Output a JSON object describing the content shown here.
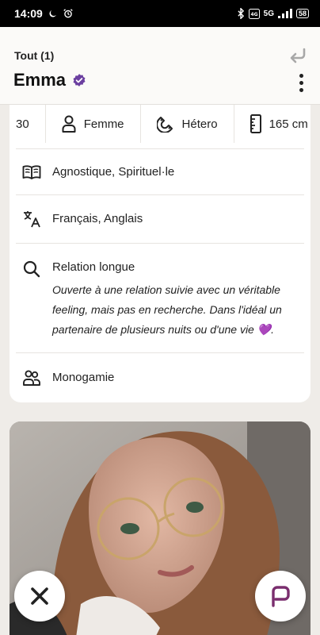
{
  "status_bar": {
    "time": "14:09",
    "net_label": "5G",
    "battery": "58"
  },
  "header": {
    "breadcrumb": "Tout (1)",
    "name": "Emma"
  },
  "chips": [
    {
      "label": "30",
      "icon": "age"
    },
    {
      "label": "Femme",
      "icon": "person-icon"
    },
    {
      "label": "Hétero",
      "icon": "magnet-icon"
    },
    {
      "label": "165 cm",
      "icon": "ruler-icon"
    }
  ],
  "details": {
    "religion": "Agnostique, Spirituel·le",
    "languages": "Français, Anglais",
    "looking_for": {
      "title": "Relation longue",
      "desc_1": "Ouverte à une relation suivie avec un véritable",
      "desc_2": "feeling, mais pas en recherche. Dans l'idéal un",
      "desc_3": "partenaire de plusieurs nuits ou d'une vie 💜."
    },
    "relationship_type": "Monogamie"
  },
  "colors": {
    "accent": "#6b3fa0",
    "chat_icon": "#7a2e6e"
  }
}
